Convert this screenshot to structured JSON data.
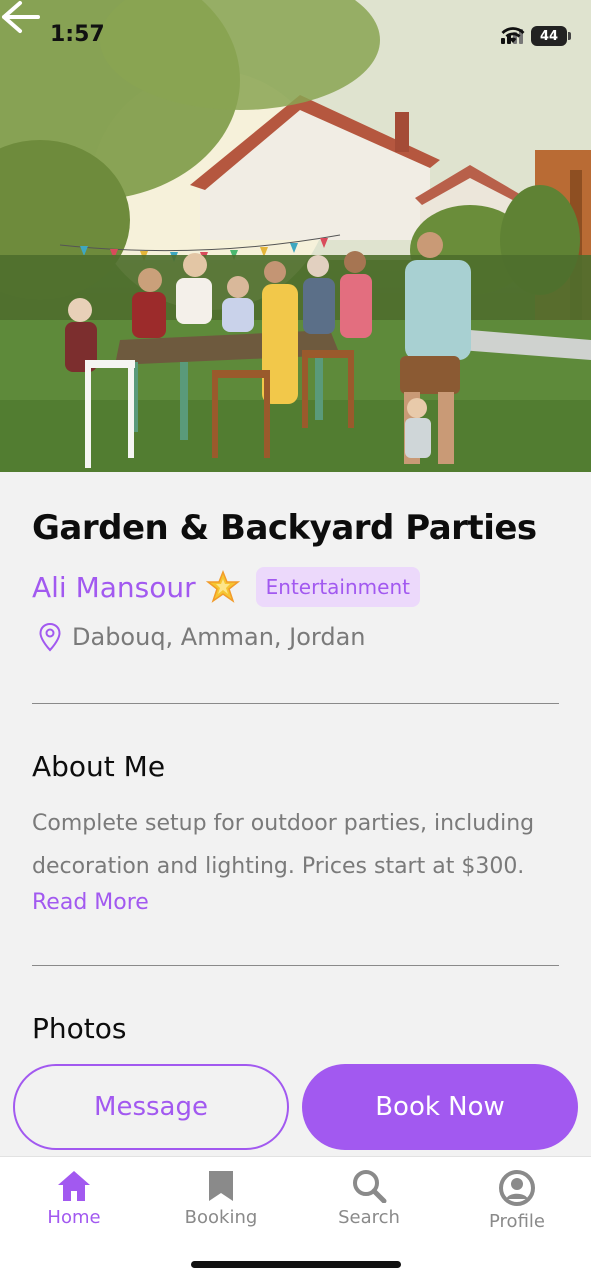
{
  "status_bar": {
    "time": "1:57",
    "battery": "44"
  },
  "hero": {
    "image_alt": "Garden party photo"
  },
  "listing": {
    "title": "Garden & Backyard Parties",
    "owner_name": "Ali Mansour",
    "category": "Entertainment",
    "location": "Dabouq, Amman, Jordan"
  },
  "about": {
    "heading": "About Me",
    "text": "Complete setup for outdoor parties, including decoration and lighting. Prices start at $300.",
    "read_more": "Read More"
  },
  "photos": {
    "heading": "Photos"
  },
  "actions": {
    "message_label": "Message",
    "book_label": "Book Now"
  },
  "tab_bar": {
    "tabs": [
      {
        "label": "Home",
        "icon": "home-icon",
        "active": true
      },
      {
        "label": "Booking",
        "icon": "bookmark-icon",
        "active": false
      },
      {
        "label": "Search",
        "icon": "search-icon",
        "active": false
      },
      {
        "label": "Profile",
        "icon": "profile-icon",
        "active": false
      }
    ]
  },
  "colors": {
    "accent": "#a259f0",
    "badge_bg": "#ecd9fb",
    "text_muted": "#7a7a7a"
  }
}
